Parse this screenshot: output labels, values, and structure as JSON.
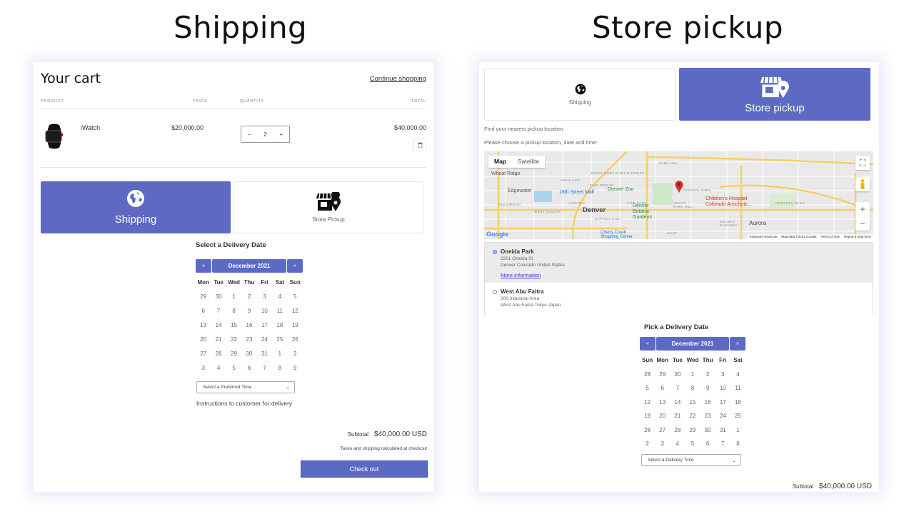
{
  "headings": {
    "left": "Shipping",
    "right": "Store pickup"
  },
  "cart": {
    "title": "Your cart",
    "continue_link": "Continue shopping",
    "columns": {
      "product": "PRODUCT",
      "price": "PRICE",
      "quantity": "QUANTITY",
      "total": "TOTAL"
    },
    "items": [
      {
        "name": "iWatch",
        "price": "$20,000.00",
        "quantity": "2",
        "total": "$40,000.00",
        "image_icon": "smartwatch-icon"
      }
    ],
    "stepper": {
      "minus": "−",
      "plus": "+"
    },
    "remove_icon": "trash-icon"
  },
  "shipping_view": {
    "methods": {
      "shipping": "Shipping",
      "store_pickup": "Store Pickup"
    },
    "date_title": "Select a Delivery Date",
    "calendar": {
      "prev": "«",
      "next": "»",
      "month": "December 2021",
      "weekdays": [
        "Mon",
        "Tue",
        "Wed",
        "Thu",
        "Fri",
        "Sat",
        "Sun"
      ],
      "days": [
        "29",
        "30",
        "1",
        "2",
        "3",
        "4",
        "5",
        "6",
        "7",
        "8",
        "9",
        "10",
        "11",
        "12",
        "13",
        "14",
        "15",
        "16",
        "17",
        "18",
        "19",
        "20",
        "21",
        "22",
        "23",
        "24",
        "25",
        "26",
        "27",
        "28",
        "29",
        "30",
        "31",
        "1",
        "2",
        "3",
        "4",
        "5",
        "6",
        "7",
        "8",
        "9"
      ]
    },
    "time_select": "Select a Preferred Time",
    "instructions": "Instructions to customer for delivery",
    "subtotal_label": "Subtotal",
    "subtotal_value": "$40,000.00 USD",
    "taxes_note": "Taxes and shipping calculated at checkout",
    "checkout_label": "Check out"
  },
  "pickup_view": {
    "methods": {
      "shipping": "Shipping",
      "store_pickup": "Store pickup"
    },
    "find_text": "Find your nearest pickup location:",
    "choose_text": "Please choose a pickup location, date and time:",
    "map": {
      "tabs": [
        "Map",
        "Satellite"
      ],
      "labels": [
        "Wheat Ridge",
        "Edgewater",
        "Denver",
        "16th Street Mall",
        "Denver Zoo",
        "Denver Botanic Gardens",
        "Children's Hospital Colorado Anschutz...",
        "Aurora",
        "Cherry Creek Shopping Center",
        "HIGHLAND",
        "FIVE POINTS",
        "RIVER NORTH ART DISTRICT",
        "AURARIA",
        "CAPITOL HILL",
        "CITY PARK",
        "PARK HILL",
        "CENTRAL PARK",
        "SOUTH PARK HILL",
        "NORFOLK GLEN",
        "DELMAR PARKWAY",
        "EDGEWOOD",
        "WEST COLFAX",
        "EAST"
      ],
      "logo": "Google",
      "footer": [
        "Keyboard shortcuts",
        "Map data ©2021 Google",
        "Terms of Use",
        "Report a map error"
      ],
      "controls": {
        "fullscreen": "⛶",
        "zoom_in": "+",
        "zoom_out": "−"
      }
    },
    "locations": [
      {
        "name": "Oneida Park",
        "address1": "2201 Oneida St",
        "address2": "Denver Colorado United States",
        "link": "More information",
        "selected": true
      },
      {
        "name": "West Abu Faitra",
        "address1": "200,Industrial Area",
        "address2": "West Abu Faitra Tokyo Japan",
        "selected": false
      }
    ],
    "date_title": "Pick a Delivery Date",
    "calendar": {
      "prev": "«",
      "next": "»",
      "month": "December 2021",
      "weekdays": [
        "Sun",
        "Mon",
        "Tue",
        "Wed",
        "Thu",
        "Fri",
        "Sat"
      ],
      "days": [
        "28",
        "29",
        "30",
        "1",
        "2",
        "3",
        "4",
        "5",
        "6",
        "7",
        "8",
        "9",
        "10",
        "11",
        "12",
        "13",
        "14",
        "15",
        "16",
        "17",
        "18",
        "19",
        "20",
        "21",
        "22",
        "23",
        "24",
        "25",
        "26",
        "27",
        "28",
        "29",
        "30",
        "31",
        "1",
        "2",
        "3",
        "4",
        "5",
        "6",
        "7",
        "8"
      ]
    },
    "time_select": "Select a Delivery Time",
    "subtotal_label": "Subtotal",
    "subtotal_value": "$40,000.00 USD"
  },
  "colors": {
    "accent": "#5c6ac4",
    "link": "#3b3bd6",
    "map_pin": "#d93025"
  }
}
